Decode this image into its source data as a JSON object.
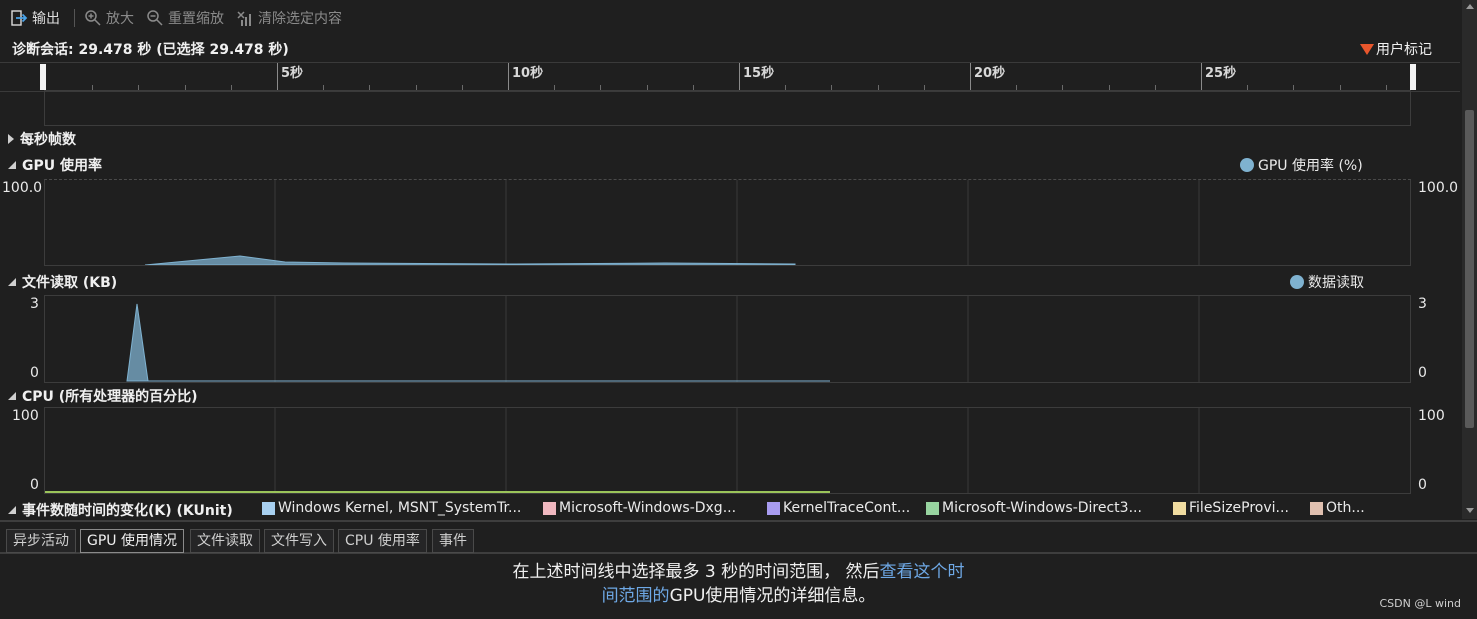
{
  "toolbar": {
    "output_label": "输出",
    "zoom_in_label": "放大",
    "reset_zoom_label": "重置缩放",
    "clear_selection_label": "清除选定内容"
  },
  "session": {
    "text": "诊断会话: 29.478 秒 (已选择 29.478 秒)",
    "user_marks_label": "用户标记"
  },
  "ruler": {
    "ticks": [
      "5秒",
      "10秒",
      "15秒",
      "20秒",
      "25秒"
    ]
  },
  "sections": {
    "fps": {
      "title": "每秒帧数"
    },
    "gpu": {
      "title": "GPU 使用率",
      "legend": "GPU 使用率 (%)",
      "y_max_left": "100.0",
      "y_max_right": "100.0"
    },
    "file_read": {
      "title": "文件读取 (KB)",
      "legend": "数据读取",
      "y_max_left": "3",
      "y_min_left": "0",
      "y_max_right": "3",
      "y_min_right": "0"
    },
    "cpu": {
      "title": "CPU (所有处理器的百分比)",
      "y_max_left": "100",
      "y_min_left": "0",
      "y_max_right": "100",
      "y_min_right": "0"
    },
    "events": {
      "title": "事件数随时间的变化(K) (KUnit)",
      "legend": [
        {
          "label": "Windows Kernel, MSNT_SystemTr...",
          "color": "#a8d0f0"
        },
        {
          "label": "Microsoft-Windows-Dxg...",
          "color": "#f0b8c0"
        },
        {
          "label": "KernelTraceCont...",
          "color": "#a89cf0"
        },
        {
          "label": "Microsoft-Windows-Direct3...",
          "color": "#98d4a0"
        },
        {
          "label": "FileSizeProvi...",
          "color": "#f0dca0"
        },
        {
          "label": "Oth...",
          "color": "#e0c0b0"
        }
      ]
    }
  },
  "colors": {
    "gpu_series": "#7fb2d0",
    "file_read_series": "#7fb2d0",
    "cpu_series": "#9bc45a",
    "user_mark": "#e8562c",
    "link": "#6ea8e5"
  },
  "tabs": [
    {
      "label": "异步活动",
      "active": false
    },
    {
      "label": "GPU 使用情况",
      "active": true
    },
    {
      "label": "文件读取",
      "active": false
    },
    {
      "label": "文件写入",
      "active": false
    },
    {
      "label": "CPU 使用率",
      "active": false
    },
    {
      "label": "事件",
      "active": false
    }
  ],
  "message": {
    "part1": "在上述时间线中选择最多 3 秒的时间范围， 然后",
    "link1": "查看这个时",
    "link2": "间范围的",
    "part2": "GPU使用情况的详细信息。"
  },
  "watermark": "CSDN @L wind"
}
